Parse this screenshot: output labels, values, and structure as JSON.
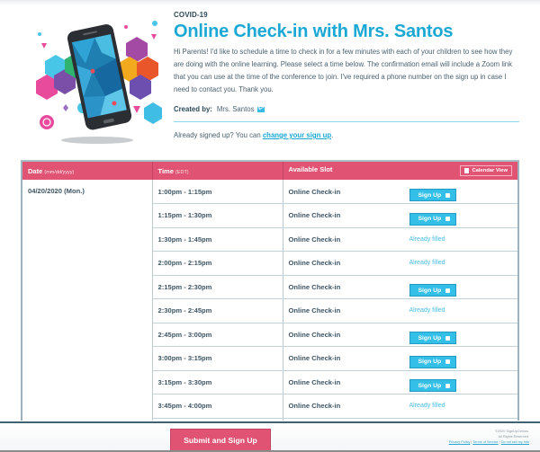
{
  "header": {
    "category": "COVID-19",
    "title": "Online Check-in with Mrs. Santos",
    "description": "Hi Parents! I'd like to schedule a time to check in for a few minutes with each of your children to see how they are doing with the online learning. Please select a time below. The confirmation email will include a Zoom link that you can use at the time of the conference to join. I've required a phone number on the sign up in case I need to contact you. Thank you.",
    "created_by_label": "Created by:",
    "created_by_name": "Mrs. Santos",
    "already_prefix": "Already signed up? You can ",
    "already_link": "change your sign up",
    "already_suffix": "."
  },
  "table": {
    "columns": {
      "date": "Date",
      "date_sub": "(mm/dd/yyyy)",
      "time": "Time",
      "time_sub": "(EDT)",
      "slot": "Available Slot",
      "calendar_view": "Calendar View"
    },
    "date": "04/20/2020 (Mon.)",
    "rows": [
      {
        "time": "1:00pm - 1:15pm",
        "slot": "Online Check-in",
        "status": "open",
        "action": "Sign Up"
      },
      {
        "time": "1:15pm - 1:30pm",
        "slot": "Online Check-in",
        "status": "open",
        "action": "Sign Up"
      },
      {
        "time": "1:30pm - 1:45pm",
        "slot": "Online Check-in",
        "status": "filled",
        "action": "Already filled"
      },
      {
        "time": "2:00pm - 2:15pm",
        "slot": "Online Check-in",
        "status": "filled",
        "action": "Already filled"
      },
      {
        "time": "2:15pm - 2:30pm",
        "slot": "Online Check-in",
        "status": "open",
        "action": "Sign Up"
      },
      {
        "time": "2:30pm - 2:45pm",
        "slot": "Online Check-in",
        "status": "filled",
        "action": "Already filled"
      },
      {
        "time": "2:45pm - 3:00pm",
        "slot": "Online Check-in",
        "status": "open",
        "action": "Sign Up"
      },
      {
        "time": "3:00pm - 3:15pm",
        "slot": "Online Check-in",
        "status": "open",
        "action": "Sign Up"
      },
      {
        "time": "3:15pm - 3:30pm",
        "slot": "Online Check-in",
        "status": "open",
        "action": "Sign Up"
      },
      {
        "time": "3:45pm - 4:00pm",
        "slot": "Online Check-in",
        "status": "filled",
        "action": "Already filled"
      }
    ]
  },
  "footer": {
    "submit_label": "Submit and Sign Up",
    "copyright": "©2020 SignUpGenius.",
    "rights": "All Rights Reserved.",
    "privacy": "Privacy Policy",
    "terms": "Terms of Service",
    "do_not_sell": "Do not sell my info",
    "separator": " | "
  },
  "colors": {
    "accent": "#1ba8d5",
    "header_pink": "#e05373",
    "signup_blue": "#33bfe8",
    "text": "#3d5566"
  }
}
